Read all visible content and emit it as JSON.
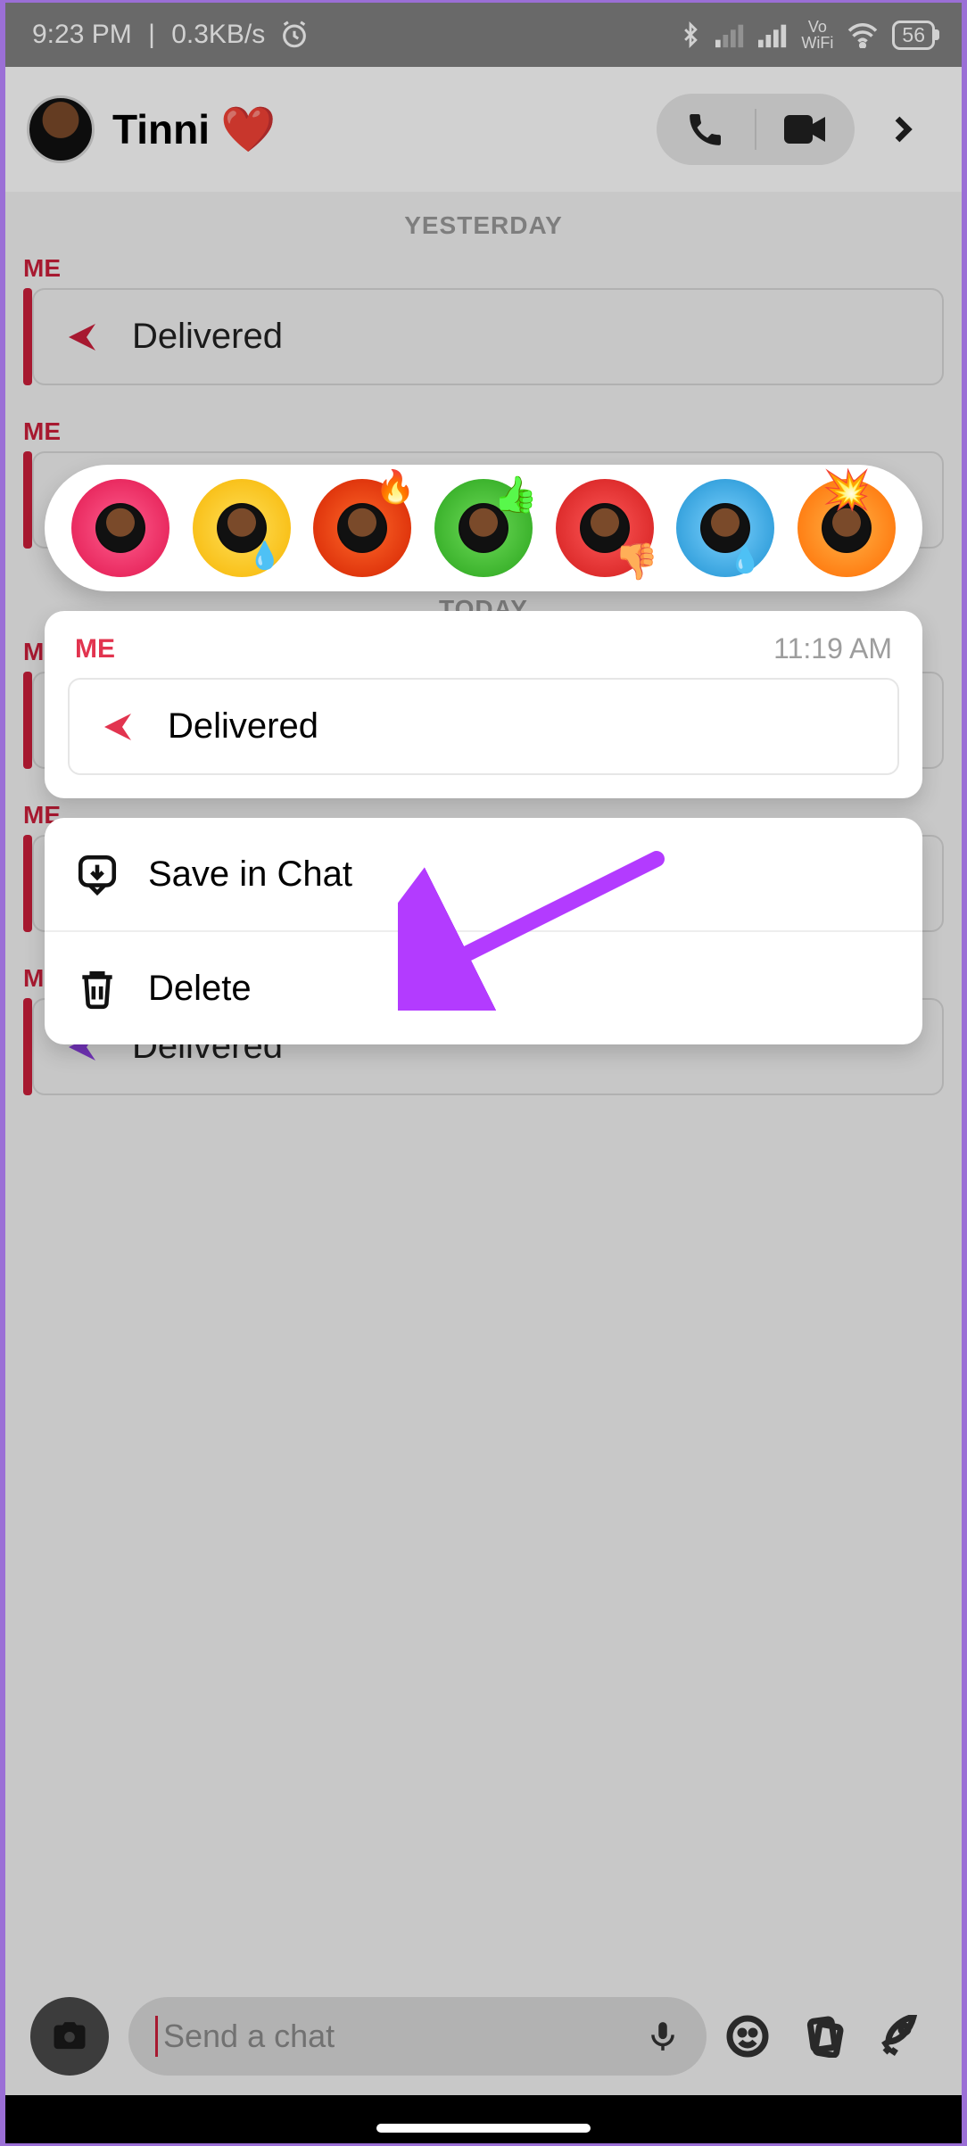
{
  "status": {
    "time": "9:23 PM",
    "net_speed": "0.3KB/s",
    "battery_pct": "56",
    "vowifi_top": "Vo",
    "vowifi_bot": "WiFi"
  },
  "header": {
    "contact_name": "Tinni",
    "heart_emoji": "❤️"
  },
  "dates": {
    "yesterday_label": "YESTERDAY",
    "today_label": "TODAY"
  },
  "messages": {
    "sender_label": "ME",
    "delivered_label": "Delivered"
  },
  "selected": {
    "sender": "ME",
    "timestamp": "11:19 AM",
    "status": "Delivered"
  },
  "reactions": {
    "heart": "heart",
    "laugh": "laugh-cry",
    "fire": "fire",
    "thumbs_up": "thumbs-up",
    "thumbs_down": "thumbs-down",
    "sad": "sad-tear",
    "mind_blown": "mind-blown"
  },
  "actions": {
    "save_label": "Save in Chat",
    "delete_label": "Delete"
  },
  "composer": {
    "placeholder": "Send a chat"
  }
}
